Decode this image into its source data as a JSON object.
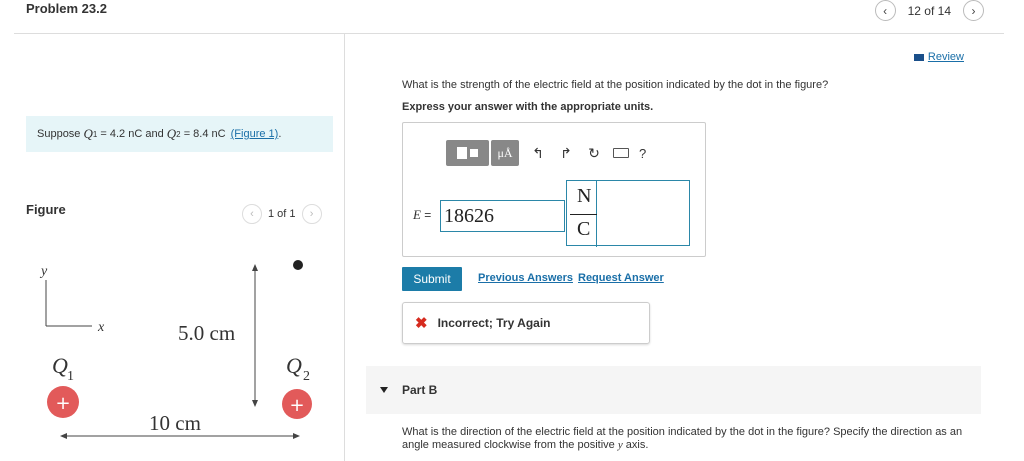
{
  "header": {
    "problem_title": "Problem 23.2",
    "pager_text": "12 of 14"
  },
  "left": {
    "suppose_prefix": "Suppose",
    "q1_symbol": "Q",
    "q1_sub": "1",
    "q1_value": "= 4.2 nC",
    "and_text": "and",
    "q2_symbol": "Q",
    "q2_sub": "2",
    "q2_value": "= 8.4 nC",
    "figure_link": "(Figure 1)",
    "period": ".",
    "figure_label": "Figure",
    "figure_pager": "1 of 1"
  },
  "figure": {
    "y_axis_label": "y",
    "x_axis_label": "x",
    "vertical_distance": "5.0 cm",
    "horizontal_distance": "10 cm",
    "q1_label": "Q",
    "q1_sub": "1",
    "q2_label": "Q",
    "q2_sub": "2",
    "charge_sign": "+",
    "charge_color": "#e25a5a"
  },
  "right": {
    "review_label": "Review",
    "question": "What is the strength of the electric field at the position indicated by the dot in the figure?",
    "instructions": "Express your answer with the appropriate units.",
    "toolbar": {
      "templates_icon": "templates-icon",
      "units_label": "μÅ",
      "undo_icon": "↰",
      "redo_icon": "↱",
      "reset_icon": "↻",
      "keyboard_icon": "keyboard-icon",
      "help_label": "?"
    },
    "equation_var": "E",
    "equation_eq": " =",
    "answer_value": "18626",
    "units_numerator": "N",
    "units_denominator": "C",
    "submit_label": "Submit",
    "previous_answers_label": "Previous Answers",
    "request_answer_label": "Request Answer",
    "feedback_icon": "✖",
    "feedback_text": "Incorrect; Try Again",
    "partb_label": "Part B",
    "partb_question_prefix": "What is the direction of the electric field at the position indicated by the dot in the figure? Specify the direction as an angle measured clockwise from the positive",
    "partb_axis": "y",
    "partb_suffix": "axis.",
    "accent_color": "#1c7ca8",
    "error_color": "#d62b1f"
  }
}
